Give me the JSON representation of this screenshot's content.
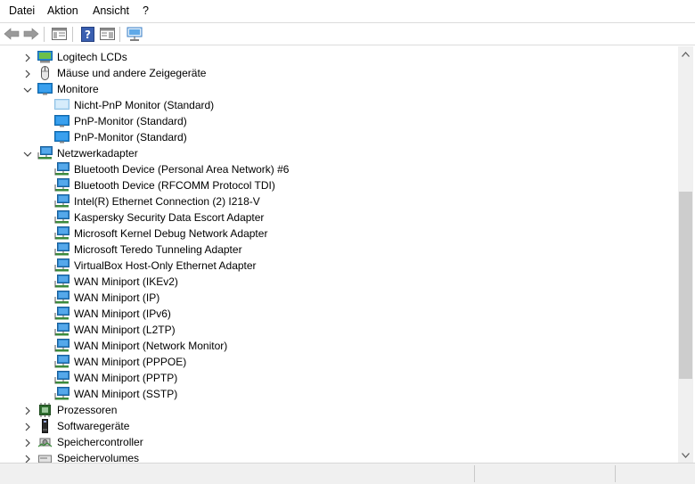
{
  "menu": {
    "items": [
      "Datei",
      "Aktion",
      "Ansicht",
      "?"
    ]
  },
  "toolbar": {
    "buttons": [
      "back-arrow-icon",
      "forward-arrow-icon",
      "properties-pane-icon",
      "help-icon",
      "console-tree-icon",
      "scan-hardware-icon"
    ]
  },
  "tree": {
    "rows": [
      {
        "label": "Logitech LCDs",
        "level": 0,
        "expander": "collapsed",
        "icon": "monitor-lcd-icon"
      },
      {
        "label": "Mäuse und andere Zeigegeräte",
        "level": 0,
        "expander": "collapsed",
        "icon": "mouse-icon"
      },
      {
        "label": "Monitore",
        "level": 0,
        "expander": "expanded",
        "icon": "monitor-icon"
      },
      {
        "label": "Nicht-PnP Monitor (Standard)",
        "level": 1,
        "expander": "none",
        "icon": "monitor-disabled-icon"
      },
      {
        "label": "PnP-Monitor (Standard)",
        "level": 1,
        "expander": "none",
        "icon": "monitor-icon"
      },
      {
        "label": "PnP-Monitor (Standard)",
        "level": 1,
        "expander": "none",
        "icon": "monitor-icon"
      },
      {
        "label": "Netzwerkadapter",
        "level": 0,
        "expander": "expanded",
        "icon": "network-adapter-icon"
      },
      {
        "label": "Bluetooth Device (Personal Area Network) #6",
        "level": 1,
        "expander": "none",
        "icon": "network-adapter-icon"
      },
      {
        "label": "Bluetooth Device (RFCOMM Protocol TDI)",
        "level": 1,
        "expander": "none",
        "icon": "network-adapter-icon"
      },
      {
        "label": "Intel(R) Ethernet Connection (2) I218-V",
        "level": 1,
        "expander": "none",
        "icon": "network-adapter-icon"
      },
      {
        "label": "Kaspersky Security Data Escort Adapter",
        "level": 1,
        "expander": "none",
        "icon": "network-adapter-icon"
      },
      {
        "label": "Microsoft Kernel Debug Network Adapter",
        "level": 1,
        "expander": "none",
        "icon": "network-adapter-icon"
      },
      {
        "label": "Microsoft Teredo Tunneling Adapter",
        "level": 1,
        "expander": "none",
        "icon": "network-adapter-icon"
      },
      {
        "label": "VirtualBox Host-Only Ethernet Adapter",
        "level": 1,
        "expander": "none",
        "icon": "network-adapter-icon"
      },
      {
        "label": "WAN Miniport (IKEv2)",
        "level": 1,
        "expander": "none",
        "icon": "network-adapter-icon"
      },
      {
        "label": "WAN Miniport (IP)",
        "level": 1,
        "expander": "none",
        "icon": "network-adapter-icon"
      },
      {
        "label": "WAN Miniport (IPv6)",
        "level": 1,
        "expander": "none",
        "icon": "network-adapter-icon"
      },
      {
        "label": "WAN Miniport (L2TP)",
        "level": 1,
        "expander": "none",
        "icon": "network-adapter-icon"
      },
      {
        "label": "WAN Miniport (Network Monitor)",
        "level": 1,
        "expander": "none",
        "icon": "network-adapter-icon"
      },
      {
        "label": "WAN Miniport (PPPOE)",
        "level": 1,
        "expander": "none",
        "icon": "network-adapter-icon"
      },
      {
        "label": "WAN Miniport (PPTP)",
        "level": 1,
        "expander": "none",
        "icon": "network-adapter-icon"
      },
      {
        "label": "WAN Miniport (SSTP)",
        "level": 1,
        "expander": "none",
        "icon": "network-adapter-icon"
      },
      {
        "label": "Prozessoren",
        "level": 0,
        "expander": "collapsed",
        "icon": "processor-icon"
      },
      {
        "label": "Softwaregeräte",
        "level": 0,
        "expander": "collapsed",
        "icon": "software-device-icon"
      },
      {
        "label": "Speichercontroller",
        "level": 0,
        "expander": "collapsed",
        "icon": "storage-controller-icon"
      },
      {
        "label": "Speichervolumes",
        "level": 0,
        "expander": "collapsed",
        "icon": "storage-volume-icon"
      }
    ]
  },
  "scrollbar": {
    "position": 0.47,
    "visible_fraction": 0.45
  },
  "colors": {
    "monitor": "#1e88d8",
    "network": "#2f7fc1",
    "background": "#ffffff",
    "status_bar": "#f0f0f0"
  }
}
